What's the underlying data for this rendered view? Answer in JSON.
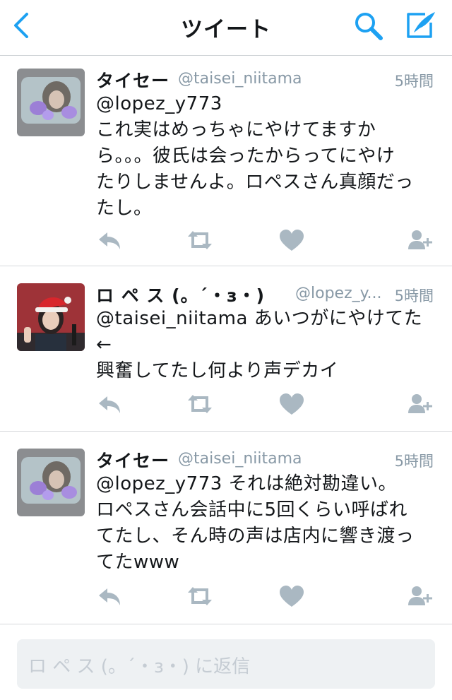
{
  "header": {
    "title": "ツイート",
    "back_icon": "chevron-left-icon",
    "search_icon": "search-icon",
    "compose_icon": "compose-icon",
    "accent": "#1da1f2"
  },
  "tweets": [
    {
      "name": "タイセー",
      "handle": "@taisei_niitama",
      "time": "5時間",
      "text": "@lopez_y773\nこれ実はめっちゃにやけてますか\nら。。。彼氏は会ったからってにやけ\nたりしませんよ。ロペスさん真顔だっ\nたし。",
      "avatar": "avatar-taisei"
    },
    {
      "name": "ロ ペ ス (。´・з・)",
      "handle": "@lopez_y...",
      "time": "5時間",
      "text": "@taisei_niitama あいつがにやけてた\n←\n興奮してたし何より声デカイ",
      "avatar": "avatar-lopez"
    },
    {
      "name": "タイセー",
      "handle": "@taisei_niitama",
      "time": "5時間",
      "text": "@lopez_y773 それは絶対勘違い。\nロペスさん会話中に5回くらい呼ばれ\nてたし、そん時の声は店内に響き渡っ\nてたwww",
      "avatar": "avatar-taisei"
    }
  ],
  "action_icons": [
    "reply-icon",
    "retweet-icon",
    "like-icon",
    "follow-icon"
  ],
  "action_color": "#aab8c2",
  "reply": {
    "placeholder": "ロ ペ ス (。´・з・) に返信"
  }
}
